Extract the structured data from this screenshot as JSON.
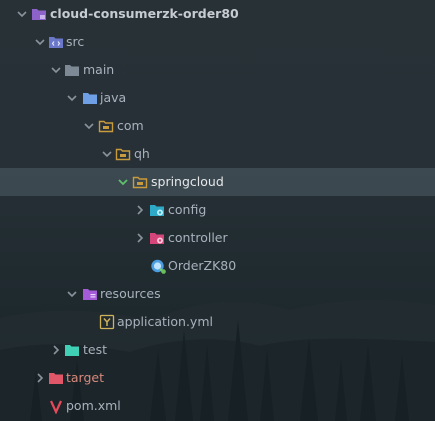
{
  "tree": {
    "root": "cloud-consumerzk-order80",
    "src": "src",
    "main": "main",
    "java": "java",
    "com": "com",
    "qh": "qh",
    "springcloud": "springcloud",
    "config": "config",
    "controller": "controller",
    "orderzk80": "OrderZK80",
    "resources": "resources",
    "application_yml": "application.yml",
    "test": "test",
    "target": "target",
    "pom_xml": "pom.xml"
  },
  "colors": {
    "folder": "#7d8a96",
    "package_folder": "#c89b3c",
    "source_folder": "#6fa0e6",
    "resources_folder": "#a45bd8",
    "test_folder": "#3fd0b5",
    "target_folder": "#e0576a",
    "selection": "#3b4a52",
    "chevron_selected": "#5fc26a"
  },
  "icons": {
    "root": "module-folder-icon",
    "src": "source-folder-icon",
    "main": "folder-icon",
    "java": "java-source-folder-icon",
    "com": "package-icon",
    "qh": "package-icon",
    "springcloud": "package-icon",
    "config": "config-package-icon",
    "controller": "controller-package-icon",
    "orderzk80": "spring-boot-class-icon",
    "resources": "resources-folder-icon",
    "application_yml": "yaml-file-icon",
    "test": "test-folder-icon",
    "target": "target-folder-icon",
    "pom_xml": "maven-file-icon"
  }
}
